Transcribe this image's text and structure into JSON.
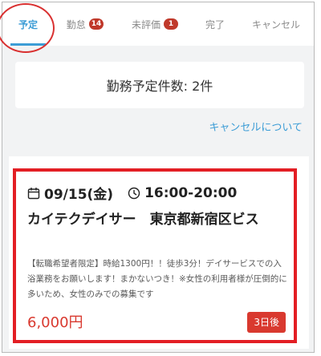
{
  "tabs": [
    {
      "label": "予定",
      "active": true
    },
    {
      "label": "勤怠",
      "badge": "14"
    },
    {
      "label": "未評価",
      "badge": "1"
    },
    {
      "label": "完了"
    },
    {
      "label": "キャンセル"
    }
  ],
  "summary": {
    "text": "勤務予定件数: 2件"
  },
  "cancel_link": "キャンセルについて",
  "job": {
    "date": "09/15(金)",
    "time": "16:00-20:00",
    "title": "カイテクデイサー　東京都新宿区ビス",
    "description": "【転職希望者限定】時給1300円！！徒歩3分！デイサービスでの入浴業務をお願いします！まかないつき！※女性の利用者様が圧倒的に多いため、女性のみでの募集です",
    "price": "6,000円",
    "days_until": "3日後"
  },
  "colors": {
    "accent": "#3d9dd6",
    "alert": "#d9392f",
    "highlight": "#e31e24"
  },
  "icons": [
    "calendar-icon",
    "clock-icon"
  ]
}
